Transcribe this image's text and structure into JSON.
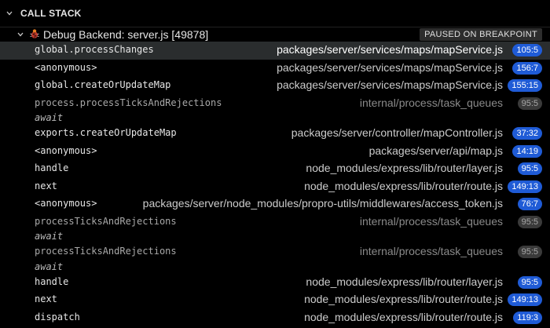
{
  "panel": {
    "title": "CALL STACK"
  },
  "session": {
    "label": "Debug Backend: server.js [49878]",
    "status": "PAUSED ON BREAKPOINT"
  },
  "frames": [
    {
      "fn": "global.processChanges",
      "path": "packages/server/services/maps/mapService.js",
      "line": "105:5",
      "dim": false,
      "selected": true
    },
    {
      "fn": "<anonymous>",
      "path": "packages/server/services/maps/mapService.js",
      "line": "156:7",
      "dim": false
    },
    {
      "fn": "global.createOrUpdateMap",
      "path": "packages/server/services/maps/mapService.js",
      "line": "155:15",
      "dim": false
    },
    {
      "fn": "process.processTicksAndRejections",
      "path": "internal/process/task_queues",
      "line": "95:5",
      "dim": true,
      "await_after": "await"
    },
    {
      "fn": "exports.createOrUpdateMap",
      "path": "packages/server/controller/mapController.js",
      "line": "37:32",
      "dim": false
    },
    {
      "fn": "<anonymous>",
      "path": "packages/server/api/map.js",
      "line": "14:19",
      "dim": false
    },
    {
      "fn": "handle",
      "path": "node_modules/express/lib/router/layer.js",
      "line": "95:5",
      "dim": false
    },
    {
      "fn": "next",
      "path": "node_modules/express/lib/router/route.js",
      "line": "149:13",
      "dim": false
    },
    {
      "fn": "<anonymous>",
      "path": "packages/server/node_modules/propro-utils/middlewares/access_token.js",
      "line": "76:7",
      "dim": false
    },
    {
      "fn": "processTicksAndRejections",
      "path": "internal/process/task_queues",
      "line": "95:5",
      "dim": true,
      "await_after": "await"
    },
    {
      "fn": "processTicksAndRejections",
      "path": "internal/process/task_queues",
      "line": "95:5",
      "dim": true,
      "await_after": "await"
    },
    {
      "fn": "handle",
      "path": "node_modules/express/lib/router/layer.js",
      "line": "95:5",
      "dim": false
    },
    {
      "fn": "next",
      "path": "node_modules/express/lib/router/route.js",
      "line": "149:13",
      "dim": false
    },
    {
      "fn": "dispatch",
      "path": "node_modules/express/lib/router/route.js",
      "line": "119:3",
      "dim": false
    }
  ],
  "colors": {
    "background": "#000000",
    "selected_row": "#2a2d2e",
    "line_badge": "#1f5bd6",
    "line_badge_dim": "#3a3a3a"
  },
  "icons": {
    "section_toggle": "chevron-down-icon",
    "session_toggle": "chevron-down-icon",
    "session_icon": "bug-icon"
  }
}
